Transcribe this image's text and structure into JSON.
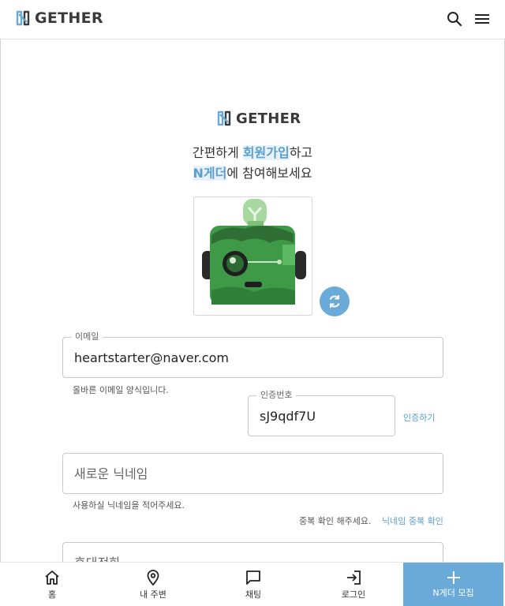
{
  "header": {
    "brand": "GETHER",
    "search_icon": "search-icon",
    "menu_icon": "hamburger-menu-icon"
  },
  "signup": {
    "brand": "GETHER",
    "tagline1_pre": "간편하게 ",
    "tagline1_hl": "회원가입",
    "tagline1_post": "하고",
    "tagline2_hl": "N게더",
    "tagline2_post": "에 참여해보세요",
    "refresh_icon": "refresh-icon"
  },
  "email": {
    "label": "이메일",
    "value": "heartstarter@naver.com",
    "helper": "올바른 이메일 양식입니다."
  },
  "verify": {
    "label": "인증번호",
    "value": "sJ9qdf7U",
    "action": "인증하기"
  },
  "nickname": {
    "placeholder": "새로운 닉네임",
    "helper": "사용하실 닉네임을 적어주세요.",
    "dup_notice": "중복 확인 해주세요.",
    "dup_action": "닉네임 중복 확인"
  },
  "phone": {
    "placeholder": "휴대전화"
  },
  "bottom_nav": {
    "items": [
      {
        "label": "홈",
        "icon": "home-icon"
      },
      {
        "label": "내 주변",
        "icon": "location-pin-icon"
      },
      {
        "label": "채팅",
        "icon": "chat-icon"
      },
      {
        "label": "로그인",
        "icon": "login-icon"
      }
    ],
    "cta": {
      "label": "N게더 모집",
      "icon": "plus-icon"
    }
  },
  "colors": {
    "accent": "#6aaad9",
    "highlight_text": "#5a9fd0",
    "avatar_green": "#3f9a47"
  }
}
